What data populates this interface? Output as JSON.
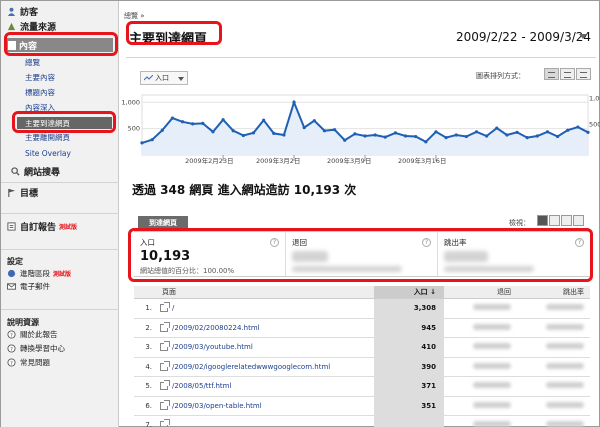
{
  "sidebar": {
    "visitors": "訪客",
    "traffic_sources": "流量來源",
    "content": "內容",
    "content_items": [
      "總覽",
      "主要內容",
      "標題內容",
      "內容深入",
      "主要到達網頁",
      "主要離開網頁",
      "Site Overlay"
    ],
    "site_search": "網站搜尋",
    "goals": "目標",
    "custom_reports": "自訂報告",
    "beta": "測試版",
    "settings": "設定",
    "advanced_segments": "進階區段",
    "email": "電子郵件",
    "help_resources": "說明資源",
    "about_report": "關於此報告",
    "conversion_university": "轉換學習中心",
    "faq": "常見問題"
  },
  "header": {
    "breadcrumb": "總覽 »",
    "title": "主要到達網頁",
    "date_range": "2009/2/22 - 2009/3/24"
  },
  "graph": {
    "metric": "入口",
    "graph_by_label": "圖表排列方式："
  },
  "chart_data": {
    "type": "line",
    "x_tick_labels": [
      "2009年2月23日",
      "2009年3月2日",
      "2009年3月9日",
      "2009年3月16日"
    ],
    "y_tick_labels_left": [
      "1,000",
      "500"
    ],
    "y_tick_labels_right": [
      "1,000",
      "500"
    ],
    "ylim": [
      0,
      1100
    ],
    "grid": true,
    "values": [
      230,
      290,
      470,
      700,
      630,
      590,
      600,
      440,
      670,
      460,
      370,
      420,
      660,
      410,
      380,
      1000,
      520,
      650,
      460,
      480,
      280,
      400,
      360,
      380,
      340,
      420,
      360,
      350,
      250,
      440,
      330,
      380,
      350,
      440,
      360,
      510,
      380,
      430,
      330,
      360,
      440,
      350,
      470,
      530,
      430
    ]
  },
  "summary": "透過 348 網頁 進入網站造訪 10,193 次",
  "tab": "到達網頁",
  "view_label": "檢視：",
  "stats": {
    "entrances_label": "入口",
    "entrances_value": "10,193",
    "entrances_sub": "網站總值的百分比：100.00%",
    "bounces_label": "退回",
    "bounce_rate_label": "跳出率"
  },
  "table": {
    "col_page": "頁面",
    "col_entrances": "入口 ↓",
    "col_bounces": "退回",
    "col_bounce_rate": "跳出率",
    "rows": [
      {
        "num": "1.",
        "page": "/",
        "entrances": "3,308"
      },
      {
        "num": "2.",
        "page": "/2009/02/20080224.html",
        "entrances": "945"
      },
      {
        "num": "3.",
        "page": "/2009/03/youtube.html",
        "entrances": "410"
      },
      {
        "num": "4.",
        "page": "/2009/02/igooglerelatedwwwgooglecom.html",
        "entrances": "390"
      },
      {
        "num": "5.",
        "page": "/2008/05/ttf.html",
        "entrances": "371"
      },
      {
        "num": "6.",
        "page": "/2009/03/open-table.html",
        "entrances": "351"
      },
      {
        "num": "7.",
        "page": "",
        "entrances": ""
      }
    ]
  }
}
